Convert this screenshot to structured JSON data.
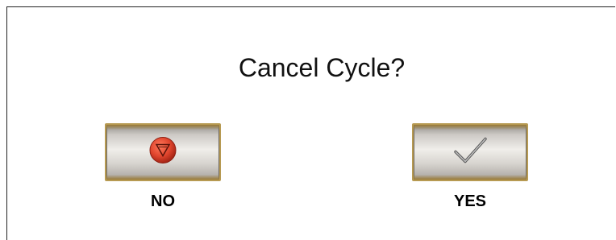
{
  "dialog": {
    "title": "Cancel Cycle?",
    "buttons": {
      "no": {
        "label": "NO",
        "icon": "stop-icon",
        "color": "#d8412b"
      },
      "yes": {
        "label": "YES",
        "icon": "checkmark-icon",
        "color": "#8a8a8a"
      }
    }
  }
}
